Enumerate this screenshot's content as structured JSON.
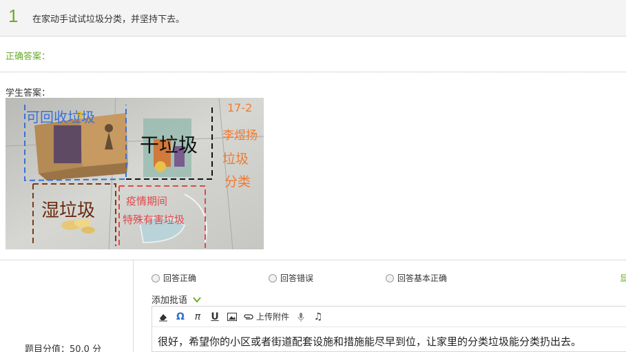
{
  "question": {
    "number": "1",
    "text": "在家动手试试垃圾分类，并坚持下去。"
  },
  "correct_answer": {
    "label": "正确答案："
  },
  "student_answer": {
    "label": "学生答案：",
    "photo_annotations": {
      "recyclable": "可回收垃圾",
      "dry": "干垃圾",
      "wet": "湿垃圾",
      "hazardous_line1": "疫情期间",
      "hazardous_line2": "特殊有害垃圾",
      "class": "17-2",
      "name": "李煜扬",
      "sort1": "垃圾",
      "sort2": "分类"
    }
  },
  "grading": {
    "score_label": "题目分值：50.0 分",
    "options": [
      "回答正确",
      "回答错误",
      "回答基本正确"
    ],
    "right_edge_text": "显"
  },
  "comment": {
    "add_label": "添加批语",
    "toolbar": {
      "upload_label": "上传附件"
    },
    "text": "很好，希望你的小区或者街道配套设施和措施能尽早到位，让家里的分类垃圾能分类扔出去。"
  }
}
